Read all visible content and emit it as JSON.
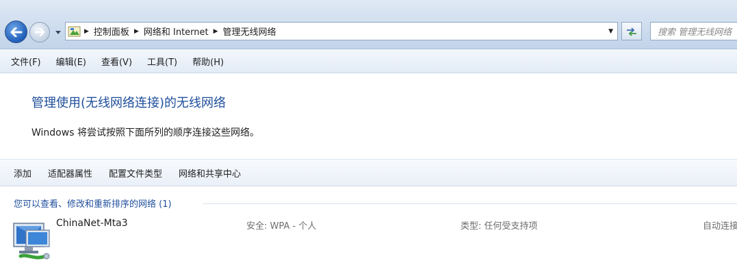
{
  "address_bar": {
    "breadcrumbs": [
      "控制面板",
      "网络和 Internet",
      "管理无线网络"
    ],
    "search_placeholder": "搜索 管理无线网络"
  },
  "icons": {
    "back": "back-arrow-icon",
    "forward": "forward-arrow-icon",
    "recent": "chevron-down-icon",
    "location": "control-panel-icon",
    "refresh": "refresh-icon",
    "network": "wireless-network-icon"
  },
  "menu": {
    "items": [
      "文件(F)",
      "编辑(E)",
      "查看(V)",
      "工具(T)",
      "帮助(H)"
    ]
  },
  "content": {
    "title": "管理使用(无线网络连接)的无线网络",
    "description": "Windows 将尝试按照下面所列的顺序连接这些网络。"
  },
  "toolbar": {
    "items": [
      "添加",
      "适配器属性",
      "配置文件类型",
      "网络和共享中心"
    ]
  },
  "network_list": {
    "group_header": "您可以查看、修改和重新排序的网络 (1)",
    "networks": [
      {
        "name": "ChinaNet-Mta3",
        "security": "安全: WPA - 个人",
        "type": "类型: 任何受支持项",
        "mode": "自动连接"
      }
    ]
  },
  "colors": {
    "accent_blue": "#1e4e9c",
    "chrome_blue": "#cfddee"
  }
}
